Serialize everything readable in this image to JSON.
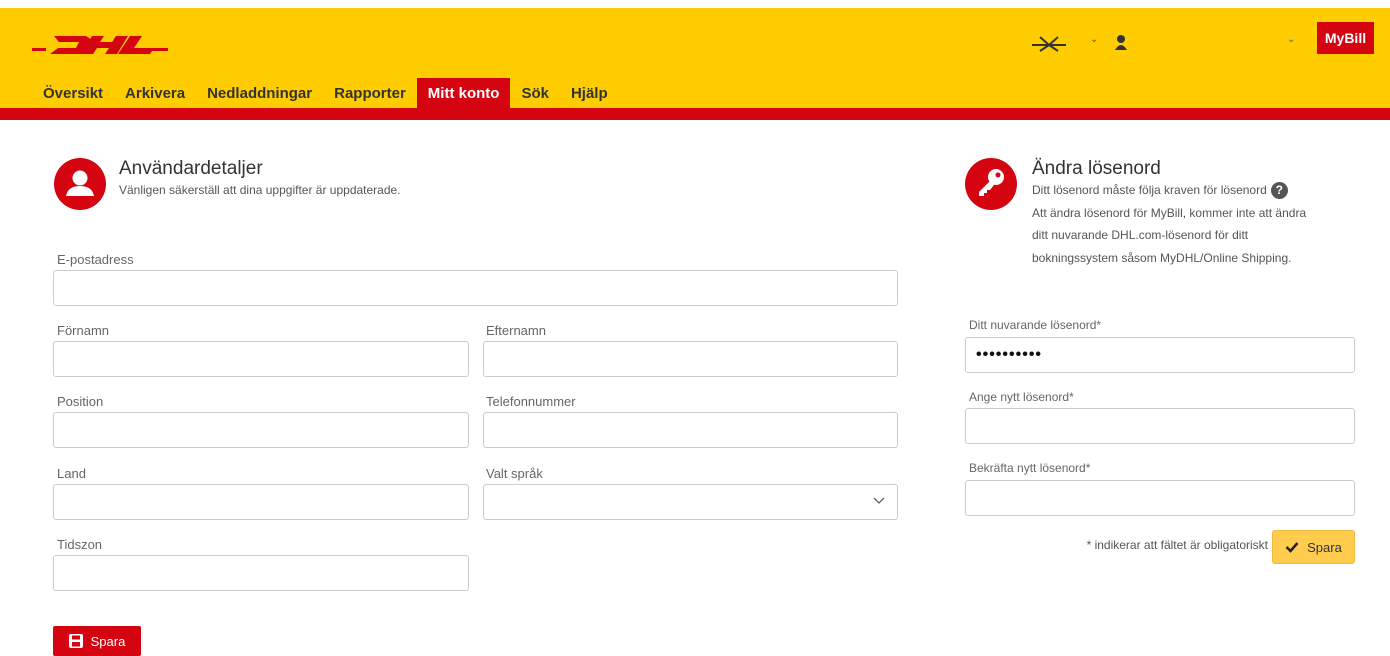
{
  "header": {
    "logo_text": "DHL",
    "mybill_label": "MyBill",
    "lang_icon": "language-icon",
    "user_icon": "user-icon"
  },
  "nav": {
    "items": [
      {
        "label": "Översikt"
      },
      {
        "label": "Arkivera"
      },
      {
        "label": "Nedladdningar"
      },
      {
        "label": "Rapporter"
      },
      {
        "label": "Mitt konto"
      },
      {
        "label": "Sök"
      },
      {
        "label": "Hjälp"
      }
    ],
    "active": "Mitt konto"
  },
  "user_details": {
    "title": "Användardetaljer",
    "subtitle": "Vänligen säkerställ att dina uppgifter är uppdaterade.",
    "email_label": "E-postadress",
    "firstname_label": "Förnamn",
    "lastname_label": "Efternamn",
    "position_label": "Position",
    "phone_label": "Telefonnummer",
    "country_label": "Land",
    "language_label": "Valt språk",
    "timezone_label": "Tidszon",
    "save_label": "Spara"
  },
  "password": {
    "title": "Ändra lösenord",
    "line1": "Ditt lösenord måste följa kraven för lösenord",
    "line2": "Att ändra lösenord för MyBill, kommer inte att ändra",
    "line3": "ditt nuvarande DHL.com-lösenord för ditt",
    "line4": "bokningssystem såsom MyDHL/Online Shipping.",
    "help": "?",
    "current_label": "Ditt nuvarande lösenord*",
    "current_value": "••••••••••",
    "new_label": "Ange nytt lösenord*",
    "confirm_label": "Bekräfta nytt lösenord*",
    "required_note": "* indikerar att fältet är obligatoriskt",
    "save_label": "Spara"
  },
  "colors": {
    "brand_yellow": "#ffcc00",
    "brand_red": "#d40511"
  }
}
